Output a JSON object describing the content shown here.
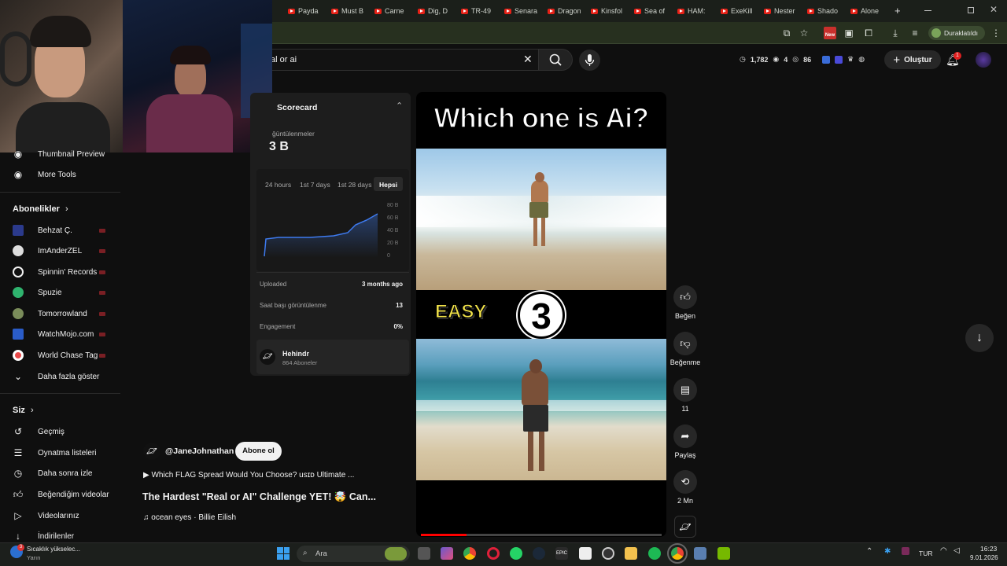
{
  "browser": {
    "tabs": [
      "Payda",
      "Must B",
      "Carne",
      "Dig, D",
      "TR-49",
      "Senara",
      "Dragon",
      "Kinsfol",
      "Sea of",
      "HAM:",
      "ExeKill",
      "Nester",
      "Shado",
      "Alone"
    ],
    "new_tab": "+",
    "profile_status": "Duraklatıldı",
    "new_badge": "New"
  },
  "youtube_header": {
    "search_value": "al or ai",
    "stats": {
      "views": "1,782",
      "watching": "4",
      "eye_count": "86"
    },
    "create_label": "Oluştur",
    "notifications_badge": "1"
  },
  "sidebar": {
    "tools": [
      {
        "label": "Thumbnail Preview",
        "icon": "tool-icon"
      },
      {
        "label": "More Tools",
        "icon": "tool-icon"
      }
    ],
    "subscriptions_header": "Abonelikler",
    "subscriptions": [
      {
        "label": "Behzat Ç.",
        "color": "#3a4aa8"
      },
      {
        "label": "ImAnderZEL",
        "color": "#e8e8e8"
      },
      {
        "label": "Spinnin' Records",
        "color": "#f1f1f1"
      },
      {
        "label": "Spuzie",
        "color": "#2fb36e"
      },
      {
        "label": "Tomorrowland",
        "color": "#7a8c5a"
      },
      {
        "label": "WatchMojo.com",
        "color": "#2a5cc8"
      },
      {
        "label": "World Chase Tag",
        "color": "#e84a4a"
      }
    ],
    "show_more": "Daha fazla göster",
    "you_header": "Siz",
    "you_items": [
      {
        "label": "Geçmiş",
        "icon": "history-icon"
      },
      {
        "label": "Oynatma listeleri",
        "icon": "playlists-icon"
      },
      {
        "label": "Daha sonra izle",
        "icon": "watch-later-icon"
      },
      {
        "label": "Beğendiğim videolar",
        "icon": "liked-icon"
      },
      {
        "label": "Videolarınız",
        "icon": "your-videos-icon"
      },
      {
        "label": "İndirilenler",
        "icon": "downloads-icon"
      }
    ]
  },
  "scorecard": {
    "title": "Scorecard",
    "views_label": "ğüntülenmeler",
    "views_value": "3 B",
    "ranges": [
      "24 hours",
      "1st 7 days",
      "1st 28 days",
      "Hepsi"
    ],
    "active_range": "Hepsi",
    "y_ticks": [
      "80 B",
      "60 B",
      "40 B",
      "20 B",
      "0"
    ],
    "rows": [
      {
        "label": "Uploaded",
        "value": "3 months ago"
      },
      {
        "label": "Saat başı görüntülenme",
        "value": "13"
      },
      {
        "label": "Engagement",
        "value": "0%"
      }
    ],
    "channel_name": "Hehindr",
    "channel_subs": "864 Aboneler"
  },
  "video": {
    "title_overlay": "Which one is Ai?",
    "easy_label": "EASY",
    "number": "3",
    "progress_fraction": 0.19
  },
  "actions": {
    "like": "Beğen",
    "dislike": "Beğenme",
    "comments": "11",
    "share": "Paylaş",
    "remix": "2 Mn"
  },
  "channel": {
    "handle": "@JaneJohnathan",
    "subscribe": "Abone ol",
    "playlist_line": "▶ Which FLAG Spread Would You Choose? usɪᴅ Ultimate ...",
    "short_title": "The Hardest \"Real or AI\" Challenge YET! 🤯 Can...",
    "music": "♫ ocean eyes · Billie Eilish"
  },
  "taskbar": {
    "weather_title": "Sıcaklık yükselec...",
    "weather_sub": "Yarın",
    "weather_badge": "3",
    "search": "Ara",
    "lang": "TUR",
    "time": "16:23",
    "date": "9.01.2026"
  }
}
